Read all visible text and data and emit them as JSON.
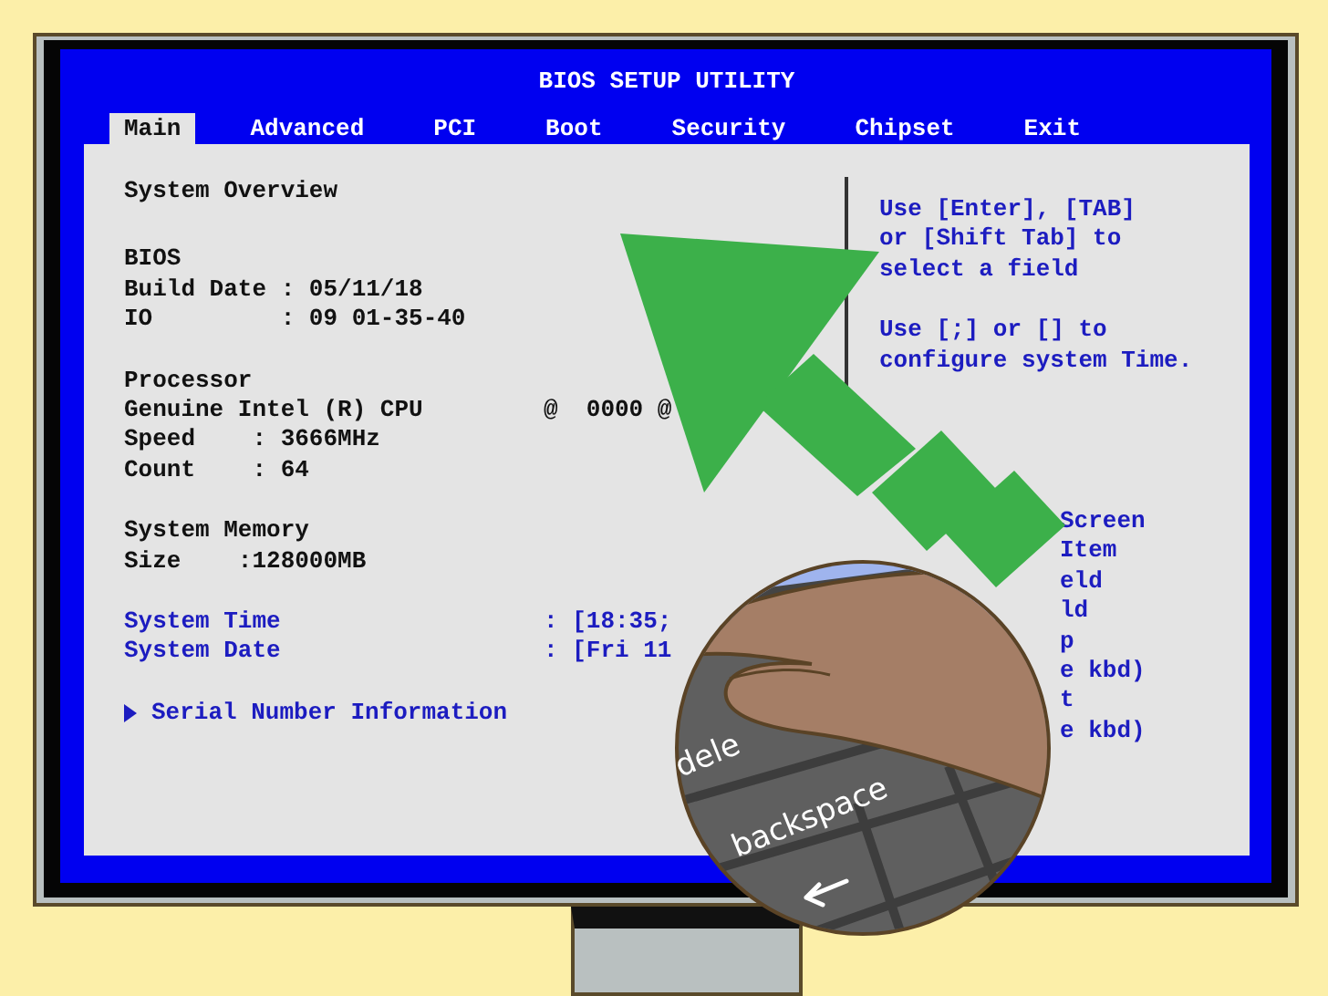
{
  "window": {
    "title": "BIOS SETUP UTILITY"
  },
  "tabs": [
    {
      "label": "Main",
      "selected": true
    },
    {
      "label": "Advanced",
      "selected": false
    },
    {
      "label": "PCI",
      "selected": false
    },
    {
      "label": "Boot",
      "selected": false
    },
    {
      "label": "Security",
      "selected": false
    },
    {
      "label": "Chipset",
      "selected": false
    },
    {
      "label": "Exit",
      "selected": false
    }
  ],
  "overview": {
    "title": "System Overview",
    "groups": [
      {
        "lines": [
          {
            "kind": "plain",
            "text": "BIOS"
          },
          {
            "kind": "plain",
            "text": "Build Date : 05/11/18"
          },
          {
            "kind": "plain",
            "text": "IO         : 09 01-35-40"
          }
        ]
      },
      {
        "lines": [
          {
            "kind": "plain",
            "text": "Processor"
          },
          {
            "kind": "field",
            "label": "Genuine Intel (R) CPU",
            "value": "@  0000 @"
          },
          {
            "kind": "plain",
            "text": "Speed    : 3666MHz"
          },
          {
            "kind": "plain",
            "text": "Count    : 64"
          }
        ]
      },
      {
        "lines": [
          {
            "kind": "plain",
            "text": "System Memory"
          },
          {
            "kind": "plain",
            "text": "Size    :128000MB"
          }
        ]
      },
      {
        "lines": [
          {
            "kind": "setting",
            "label": "System Time",
            "value": ": [18:35;"
          },
          {
            "kind": "setting",
            "label": "System Date",
            "value": ": [Fri 11"
          }
        ]
      },
      {
        "lines": [
          {
            "kind": "submenu",
            "text": "Serial Number Information"
          }
        ]
      }
    ]
  },
  "help": {
    "paragraphs": [
      "Use [Enter], [TAB]\nor [Shift Tab] to\nselect a field",
      "Use [;] or [] to\nconfigure system Time."
    ],
    "keys": [
      "Screen",
      "Item",
      "eld",
      "ld",
      "p",
      "e kbd)",
      "t",
      "e kbd)"
    ]
  },
  "inset": {
    "key_labels": [
      "dele",
      "backspace"
    ]
  }
}
